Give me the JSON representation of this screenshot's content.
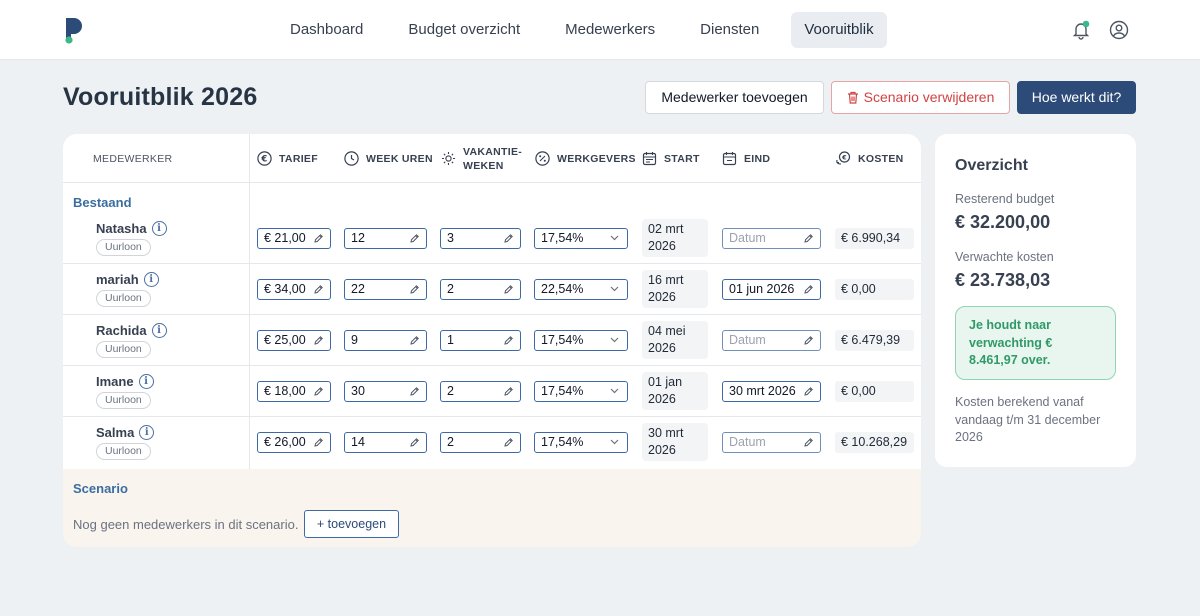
{
  "nav": {
    "items": [
      {
        "label": "Dashboard",
        "active": false
      },
      {
        "label": "Budget overzicht",
        "active": false
      },
      {
        "label": "Medewerkers",
        "active": false
      },
      {
        "label": "Diensten",
        "active": false
      },
      {
        "label": "Vooruitblik",
        "active": true
      }
    ],
    "icons": [
      "logo",
      "bell-icon",
      "user-icon"
    ]
  },
  "page": {
    "title": "Vooruitblik 2026",
    "buttons": {
      "add_employee": "Medewerker toevoegen",
      "delete_scenario": "Scenario verwijderen",
      "help": "Hoe werkt dit?"
    }
  },
  "table": {
    "headers": {
      "medewerker": "MEDEWERKER",
      "tarief": "TARIEF",
      "week_uren": "WEEK UREN",
      "vakantie_line1": "VAKANTIE-",
      "vakantie_line2": "WEKEN",
      "werkgevers": "WERKGEVERS",
      "start": "START",
      "eind": "EIND",
      "kosten": "KOSTEN"
    },
    "section_existing": "Bestaand",
    "rows": [
      {
        "name": "Natasha",
        "type": "Uurloon",
        "tarief": "€ 21,00",
        "week_uren": "12",
        "vakantie": "3",
        "werkgevers": "17,54%",
        "start_line1": "02 mrt",
        "start_line2": "2026",
        "eind": "Datum",
        "eind_is_placeholder": true,
        "kosten": "€ 6.990,34"
      },
      {
        "name": "mariah",
        "type": "Uurloon",
        "tarief": "€ 34,00",
        "week_uren": "22",
        "vakantie": "2",
        "werkgevers": "22,54%",
        "start_line1": "16 mrt",
        "start_line2": "2026",
        "eind": "01 jun 2026",
        "eind_is_placeholder": false,
        "kosten": "€ 0,00"
      },
      {
        "name": "Rachida",
        "type": "Uurloon",
        "tarief": "€ 25,00",
        "week_uren": "9",
        "vakantie": "1",
        "werkgevers": "17,54%",
        "start_line1": "04 mei",
        "start_line2": "2026",
        "eind": "Datum",
        "eind_is_placeholder": true,
        "kosten": "€ 6.479,39"
      },
      {
        "name": "Imane",
        "type": "Uurloon",
        "tarief": "€ 18,00",
        "week_uren": "30",
        "vakantie": "2",
        "werkgevers": "17,54%",
        "start_line1": "01 jan",
        "start_line2": "2026",
        "eind": "30 mrt 2026",
        "eind_is_placeholder": false,
        "kosten": "€ 0,00"
      },
      {
        "name": "Salma",
        "type": "Uurloon",
        "tarief": "€ 26,00",
        "week_uren": "14",
        "vakantie": "2",
        "werkgevers": "17,54%",
        "start_line1": "30 mrt",
        "start_line2": "2026",
        "eind": "Datum",
        "eind_is_placeholder": true,
        "kosten": "€ 10.268,29"
      }
    ],
    "section_scenario": "Scenario",
    "scenario_empty": "Nog geen medewerkers in dit scenario.",
    "scenario_add": "+ toevoegen"
  },
  "overview": {
    "title": "Overzicht",
    "remaining_label": "Resterend budget",
    "remaining_value": "€ 32.200,00",
    "expected_label": "Verwachte kosten",
    "expected_value": "€ 23.738,03",
    "alert": "Je houdt naar verwachting € 8.461,97 over.",
    "note": "Kosten berekend vanaf vandaag t/m 31 december 2026"
  },
  "colors": {
    "primary": "#2c4b78",
    "link": "#3b6da1",
    "danger": "#d14343",
    "success": "#2f9a67",
    "background": "#eef1f4"
  }
}
